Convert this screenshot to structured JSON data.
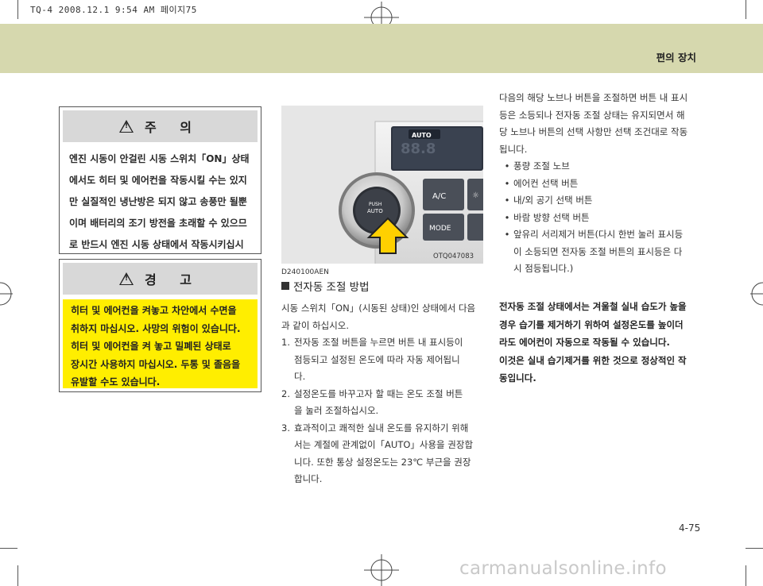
{
  "print_header": "TQ-4 2008.12.1 9:54 AM 페이지75",
  "section_title": "편의 장치",
  "caution": {
    "title": "주 의",
    "lines": [
      "엔진 시동이 안걸린 시동 스위치「ON」상태",
      "에서도 히터 및 에어컨을 작동시킬 수는 있지",
      "만 실질적인 냉난방은 되지 않고 송풍만 될뿐",
      "이며 배터리의 조기 방전을 초래할 수 있으므",
      "로 반드시 엔진 시동 상태에서 작동시키십시",
      "오."
    ]
  },
  "warning": {
    "title": "경 고",
    "lines": [
      "히터 및 에어컨을 켜놓고 차안에서 수면을",
      "취하지 마십시오. 사망의 위험이 있습니다.",
      "히터 및 에어컨을 켜 놓고 밀폐된 상태로",
      "장시간 사용하지 마십시오. 두통 및 졸음을",
      "유발할 수도 있습니다."
    ]
  },
  "photo": {
    "code": "OTQ047083",
    "labels": {
      "auto": "AUTO",
      "push": "PUSH",
      "knob_auto": "AUTO",
      "ac": "A/C",
      "mode": "MODE"
    }
  },
  "ref_code": "D240100AEN",
  "subheading": "전자동 조절 방법",
  "intro_lines": [
    "시동 스위치「ON」(시동된 상태)인 상태에서 다음",
    "과 같이 하십시오."
  ],
  "steps": [
    {
      "num": "1.",
      "lines": [
        "전자동 조절 버튼을 누르면 버튼 내 표시등이",
        "점등되고 설정된 온도에 따라 자동 제어됩니",
        "다."
      ]
    },
    {
      "num": "2.",
      "lines": [
        "설정온도를 바꾸고자 할 때는 온도 조절 버튼",
        "을 눌러 조절하십시오."
      ]
    },
    {
      "num": "3.",
      "lines": [
        "효과적이고 쾌적한 실내 온도를 유지하기 위해",
        "서는 계절에 관계없이「AUTO」사용을 권장합",
        "니다. 또한 통상 설정온도는 23℃ 부근을 권장",
        "합니다."
      ]
    }
  ],
  "right_intro_lines": [
    "다음의 해당 노브나 버튼을 조절하면 버튼 내 표시",
    "등은 소등되나 전자동 조절 상태는 유지되면서 해",
    "당 노브나 버튼의 선택 사항만 선택 조건대로 작동",
    "됩니다."
  ],
  "bullets": [
    {
      "lines": [
        "풍량 조절 노브"
      ]
    },
    {
      "lines": [
        "에어컨 선택 버튼"
      ]
    },
    {
      "lines": [
        "내/외 공기 선택 버튼"
      ]
    },
    {
      "lines": [
        "바람 방향 선택 버튼"
      ]
    },
    {
      "lines": [
        "앞유리 서리제거 버튼(다시 한번 눌러 표시등",
        "이 소등되면 전자동 조절 버튼의 표시등은 다",
        "시 점등됩니다.)"
      ]
    }
  ],
  "right_bold_lines": [
    "전자동 조절 상태에서는 겨울철 실내 습도가 높을",
    "경우 습기를 제거하기 위하여 설정온도를 높이더",
    "라도 에어컨이 자동으로 작동될 수 있습니다.",
    "이것은 실내 습기제거를 위한 것으로 정상적인 작",
    "동입니다."
  ],
  "page_number": "4-75",
  "watermark": "carmanualsonline.info"
}
